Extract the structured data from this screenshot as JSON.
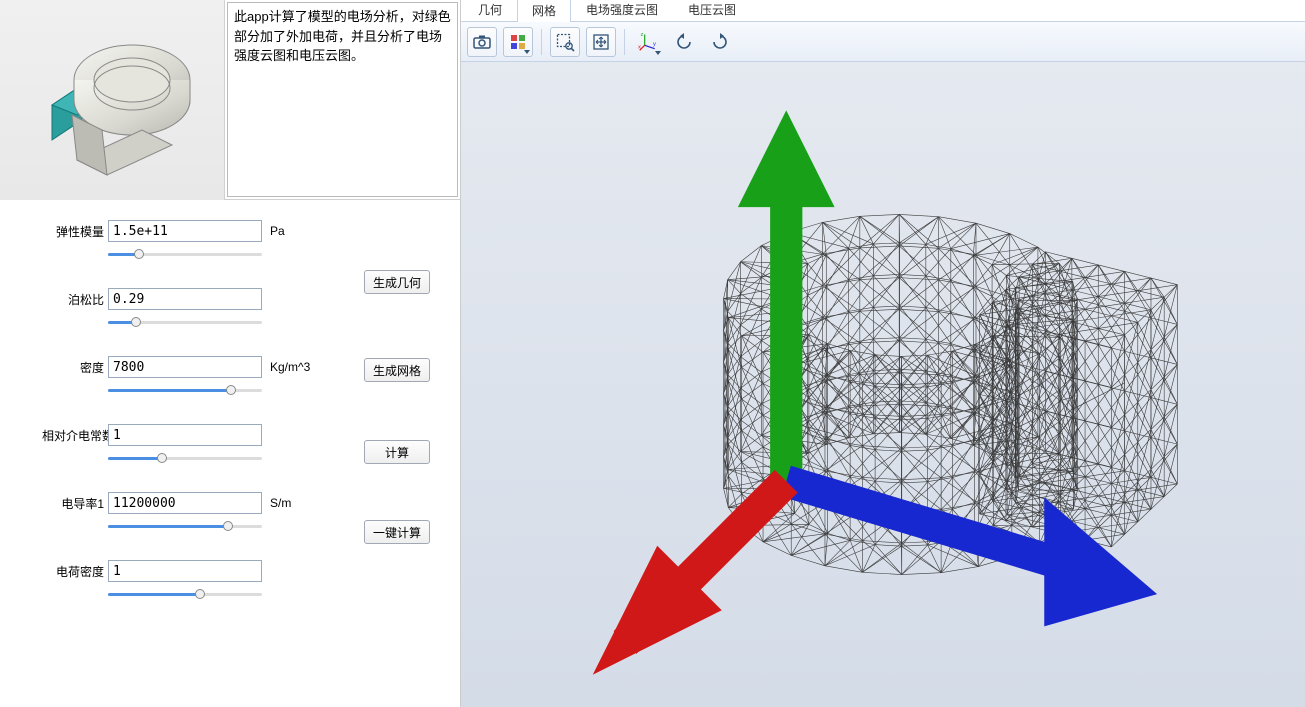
{
  "description": "此app计算了模型的电场分析，对绿色部分加了外加电荷，并且分析了电场强度云图和电压云图。",
  "params": {
    "elastic": {
      "label": "弹性模量",
      "value": "1.5e+11",
      "unit": "Pa",
      "slider_pct": 20
    },
    "poisson": {
      "label": "泊松比",
      "value": "0.29",
      "unit": "",
      "slider_pct": 18
    },
    "density": {
      "label": "密度",
      "value": "7800",
      "unit": "Kg/m^3",
      "slider_pct": 80
    },
    "permittivity": {
      "label": "相对介电常数",
      "value": "1",
      "unit": "",
      "slider_pct": 35
    },
    "conductivity": {
      "label": "电导率1",
      "value": "11200000",
      "unit": "S/m",
      "slider_pct": 78
    },
    "charge": {
      "label": "电荷密度",
      "value": "1",
      "unit": "",
      "slider_pct": 60
    }
  },
  "buttons": {
    "gen_geom": "生成几何",
    "gen_mesh": "生成网格",
    "compute": "计算",
    "one_click": "一键计算"
  },
  "tabs": {
    "geometry": "几何",
    "mesh": "网格",
    "efield": "电场强度云图",
    "voltage": "电压云图",
    "active": "mesh"
  },
  "toolbar_icons": {
    "screenshot": "screenshot-icon",
    "layers": "layers-icon",
    "zoom_box": "zoom-box-icon",
    "zoom_extents": "zoom-extents-icon",
    "axes": "axes-icon",
    "rotate_cw": "rotate-cw-icon",
    "rotate_ccw": "rotate-ccw-icon"
  }
}
